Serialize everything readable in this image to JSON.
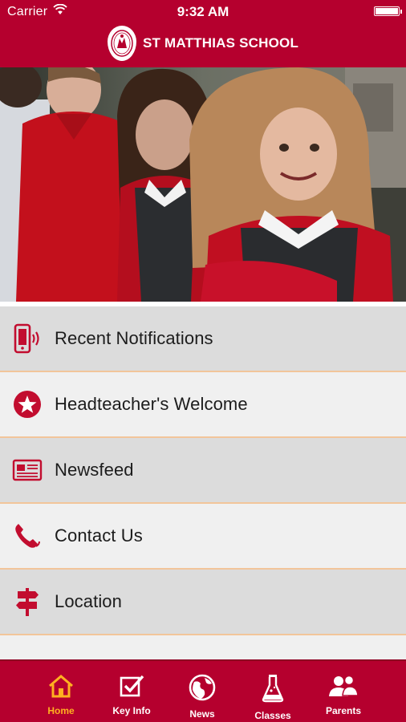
{
  "status_bar": {
    "carrier": "Carrier",
    "time": "9:32 AM"
  },
  "header": {
    "school_name": "ST MATTHIAS SCHOOL"
  },
  "menu": {
    "items": [
      {
        "label": "Recent Notifications",
        "icon": "phone-notification-icon"
      },
      {
        "label": "Headteacher's Welcome",
        "icon": "star-icon"
      },
      {
        "label": "Newsfeed",
        "icon": "newspaper-icon"
      },
      {
        "label": "Contact Us",
        "icon": "telephone-icon"
      },
      {
        "label": "Location",
        "icon": "signpost-icon"
      }
    ]
  },
  "tabbar": {
    "tabs": [
      {
        "label": "Home",
        "icon": "home-icon",
        "active": true
      },
      {
        "label": "Key Info",
        "icon": "checkbox-icon",
        "active": false
      },
      {
        "label": "News",
        "icon": "globe-icon",
        "active": false
      },
      {
        "label": "Classes",
        "icon": "flask-icon",
        "active": false
      },
      {
        "label": "Parents",
        "icon": "people-icon",
        "active": false
      }
    ]
  },
  "colors": {
    "brand": "#b5002e",
    "active_tab": "#ffb020",
    "row_dark": "#dcdcdc",
    "row_light": "#f0f0f0",
    "row_divider": "#f2c59a"
  }
}
